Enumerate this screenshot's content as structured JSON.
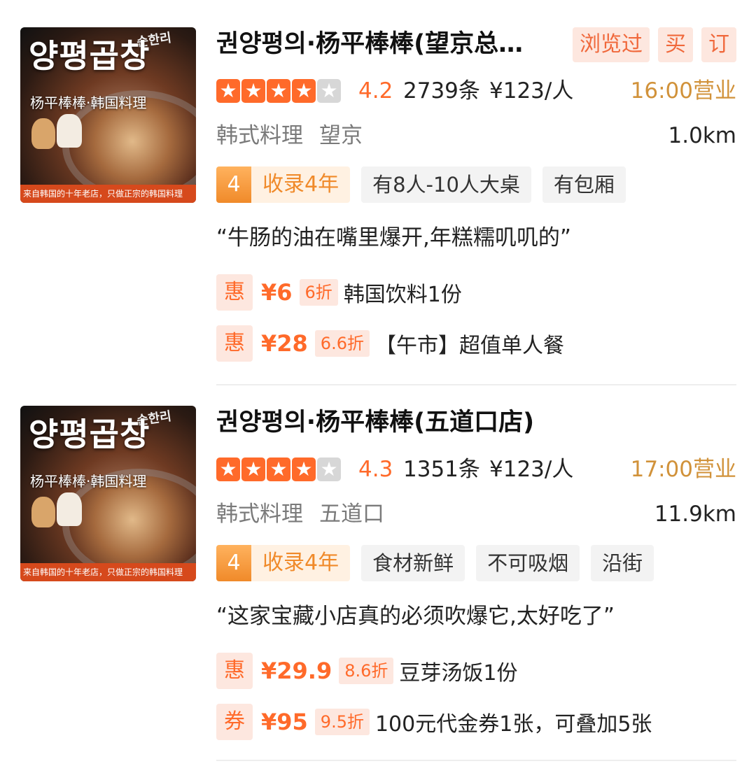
{
  "restaurants": [
    {
      "name": "권양평의·杨平棒棒(望京总…",
      "badges": [
        "浏览过",
        "买",
        "订"
      ],
      "score": "4.2",
      "stars_filled": 4,
      "reviews": "2739条",
      "price": "¥123/人",
      "open": "16:00营业",
      "category": "韩式料理",
      "area": "望京",
      "distance": "1.0km",
      "years_num": "4",
      "years_label": "收录4年",
      "tags": [
        "有8人-10人大桌",
        "有包厢"
      ],
      "quote": "“牛肠的油在嘴里爆开,年糕糯叽叽的”",
      "deals": [
        {
          "type": "惠",
          "price": "¥6",
          "discount": "6折",
          "title": "韩国饮料1份"
        },
        {
          "type": "惠",
          "price": "¥28",
          "discount": "6.6折",
          "title": "【午市】超值单人餐"
        }
      ],
      "thumb": {
        "korean": "양평곱창",
        "korean_small": "순한리",
        "chinese": "杨平棒棒·韩国料理",
        "banner": "来自韩国的十年老店，只做正宗的韩国料理"
      }
    },
    {
      "name": "권양평의·杨平棒棒(五道口店)",
      "badges": [],
      "score": "4.3",
      "stars_filled": 4,
      "reviews": "1351条",
      "price": "¥123/人",
      "open": "17:00营业",
      "category": "韩式料理",
      "area": "五道口",
      "distance": "11.9km",
      "years_num": "4",
      "years_label": "收录4年",
      "tags": [
        "食材新鲜",
        "不可吸烟",
        "沿街"
      ],
      "quote": "“这家宝藏小店真的必须吹爆它,太好吃了”",
      "deals": [
        {
          "type": "惠",
          "price": "¥29.9",
          "discount": "8.6折",
          "title": "豆芽汤饭1份"
        },
        {
          "type": "券",
          "price": "¥95",
          "discount": "9.5折",
          "title": "100元代金券1张，可叠加5张"
        }
      ],
      "thumb": {
        "korean": "양평곱창",
        "korean_small": "순한리",
        "chinese": "杨平棒棒·韩国料理",
        "banner": "来自韩国的十年老店，只做正宗的韩国料理"
      }
    }
  ]
}
